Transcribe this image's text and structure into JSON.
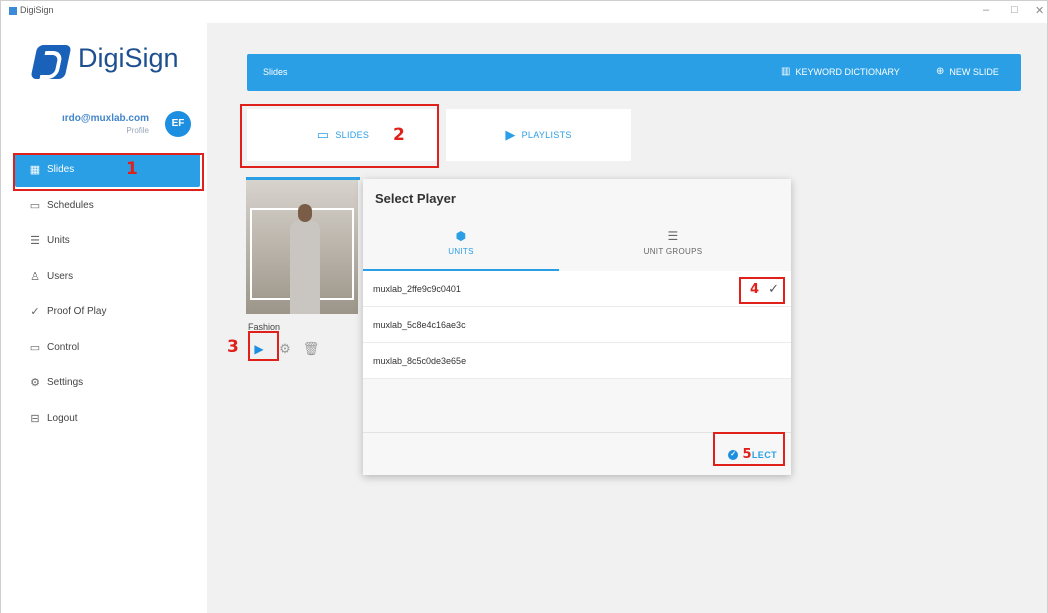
{
  "window": {
    "title": "DigiSign",
    "min": "–",
    "max": "□",
    "close": "✕"
  },
  "sidebar": {
    "brand": "DigiSign",
    "email": "ırdo@muxlab.com",
    "profile_label": "Profile",
    "avatar_initials": "EF",
    "items": [
      {
        "label": "Slides",
        "icon": "grid-icon",
        "glyph": "▦",
        "active": true
      },
      {
        "label": "Schedules",
        "icon": "calendar-icon",
        "glyph": "▭",
        "active": false
      },
      {
        "label": "Units",
        "icon": "server-icon",
        "glyph": "☰",
        "active": false
      },
      {
        "label": "Users",
        "icon": "user-icon",
        "glyph": "♙",
        "active": false
      },
      {
        "label": "Proof Of Play",
        "icon": "pulse-icon",
        "glyph": "✓",
        "active": false
      },
      {
        "label": "Control",
        "icon": "monitor-icon",
        "glyph": "▭",
        "active": false
      },
      {
        "label": "Settings",
        "icon": "gear-icon",
        "glyph": "⚙",
        "active": false
      },
      {
        "label": "Logout",
        "icon": "logout-icon",
        "glyph": "⊟",
        "active": false
      }
    ]
  },
  "topbar": {
    "title": "Slides",
    "keyword_dictionary": "KEYWORD DICTIONARY",
    "new_slide": "NEW SLIDE"
  },
  "tabs": {
    "slides": "SLIDES",
    "playlists": "PLAYLISTS"
  },
  "slide_card": {
    "name": "Fashion"
  },
  "dialog": {
    "title": "Select Player",
    "tab_units": "UNITS",
    "tab_unit_groups": "UNIT GROUPS",
    "units": [
      "muxlab_2ffe9c9c0401",
      "muxlab_5c8e4c16ae3c",
      "muxlab_8c5c0de3e65e"
    ],
    "select_visible": "LECT",
    "select_step_number": "5"
  },
  "annotations": [
    "1",
    "2",
    "3",
    "4",
    "5"
  ],
  "colors": {
    "accent": "#2a9fe6",
    "annotation": "#e0201b",
    "brand": "#1e4f8e"
  }
}
